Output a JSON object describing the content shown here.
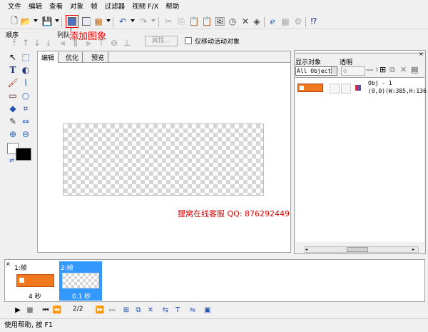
{
  "menu": [
    "文件",
    "编辑",
    "查看",
    "对象",
    "帧",
    "过滤器",
    "视频 F/X",
    "帮助"
  ],
  "annotation_add_image": "添加图象",
  "watermark": "狸窝在线客服 QQ: 876292449",
  "toolbar2": {
    "order_label": "顺序",
    "queue_label": "列队",
    "properties_button": "属性...",
    "move_active_only": "仅移动活动对象"
  },
  "tabs": [
    "编辑",
    "优化",
    "预览"
  ],
  "right_panel": {
    "show_objects_label": "显示对象",
    "transparency_label": "透明",
    "show_select_value": "All Object:",
    "transparency_value": "0",
    "object": {
      "name": "Obj - 1",
      "info": "(0,0)(W:385,H:136"
    }
  },
  "timeline": {
    "frames": [
      {
        "label": "1:帧",
        "duration": "4 秒"
      },
      {
        "label": "2:帧",
        "duration": "0.1 秒"
      }
    ]
  },
  "controls": {
    "counter": "2/2"
  },
  "status": "使用帮助, 按 F1",
  "colors": {
    "accent": "#3399ff",
    "annotation": "#ff0000",
    "thumb_orange": "#f0781e"
  }
}
